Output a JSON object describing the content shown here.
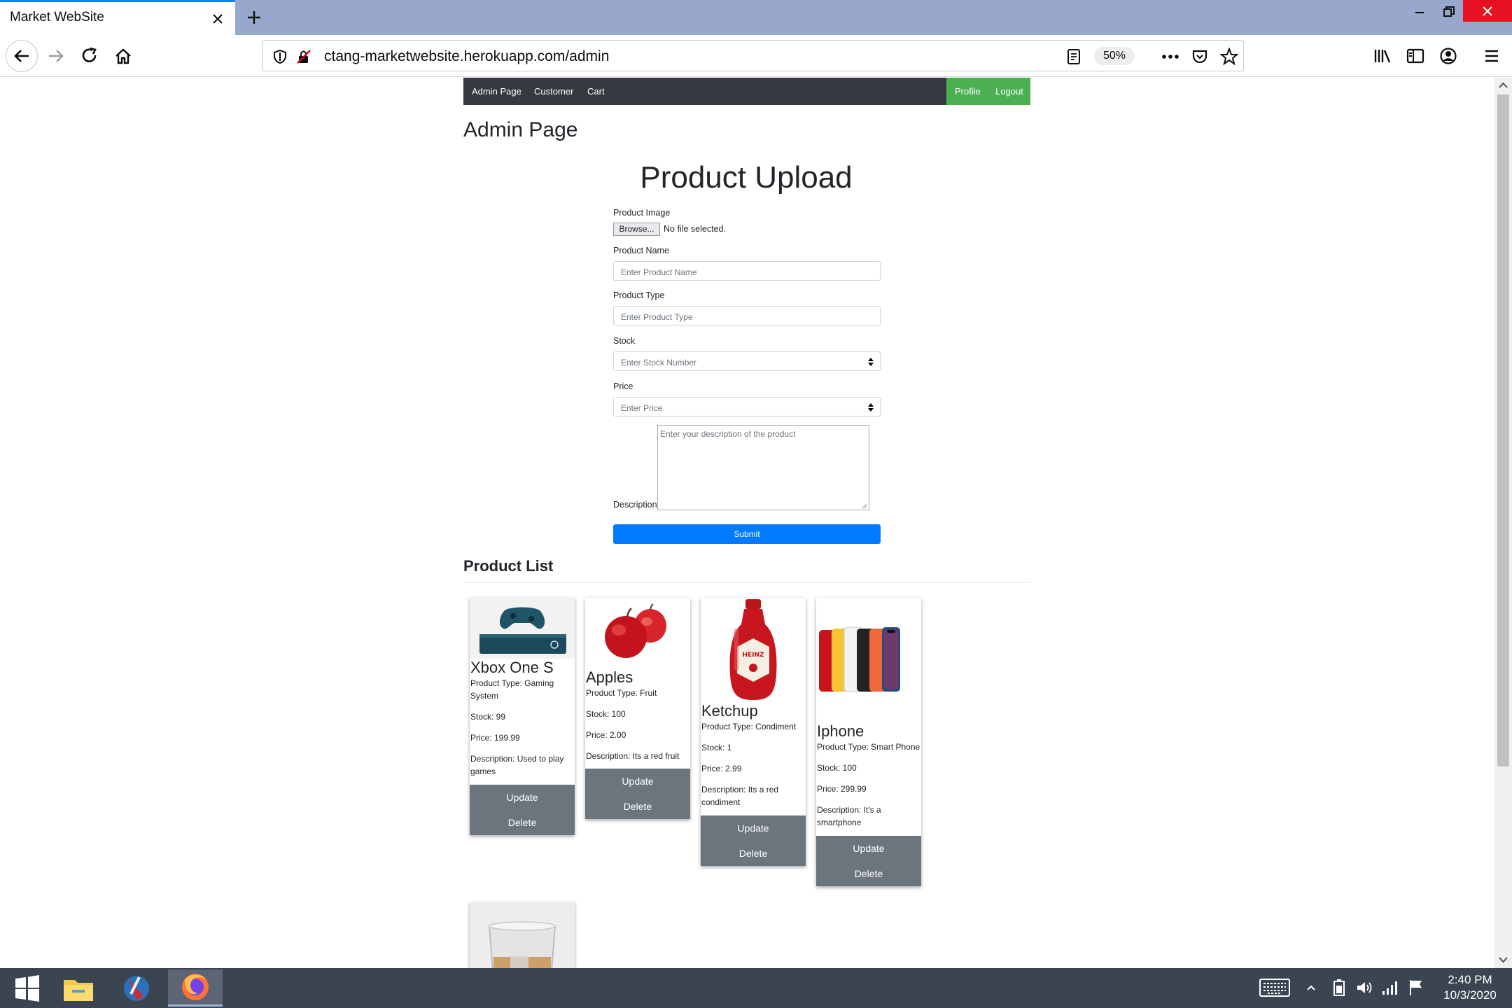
{
  "browser": {
    "tab_title": "Market WebSite",
    "url": "ctang-marketwebsite.herokuapp.com/admin",
    "zoom": "50%"
  },
  "site_nav": {
    "links": [
      "Admin Page",
      "Customer",
      "Cart"
    ],
    "right_links": [
      "Profile",
      "Logout"
    ]
  },
  "page": {
    "heading": "Admin Page"
  },
  "upload_form": {
    "title": "Product Upload",
    "image_label": "Product Image",
    "browse_label": "Browse...",
    "file_status": "No file selected.",
    "name_label": "Product Name",
    "name_placeholder": "Enter Product Name",
    "type_label": "Product Type",
    "type_placeholder": "Enter Product Type",
    "stock_label": "Stock",
    "stock_placeholder": "Enter Stock Number",
    "price_label": "Price",
    "price_placeholder": "Enter Price",
    "description_label": "Description",
    "description_placeholder": "Enter your description of the product",
    "submit_label": "Submit"
  },
  "product_list": {
    "heading": "Product List",
    "update_label": "Update",
    "delete_label": "Delete",
    "products": [
      {
        "name": "Xbox One S",
        "type": "Product Type: Gaming System",
        "stock": "Stock: 99",
        "price": "Price: 199.99",
        "description": "Description: Used to play games"
      },
      {
        "name": "Apples",
        "type": "Product Type: Fruit",
        "stock": "Stock: 100",
        "price": "Price: 2.00",
        "description": "Description: Its a red fruit"
      },
      {
        "name": "Ketchup",
        "type": "Product Type: Condiment",
        "stock": "Stock: 1",
        "price": "Price: 2.99",
        "description": "Description: Its a red condiment"
      },
      {
        "name": "Iphone",
        "type": "Product Type: Smart Phone",
        "stock": "Stock: 100",
        "price": "Price: 299.99",
        "description": "Description: It's a smartphone"
      }
    ]
  },
  "taskbar": {
    "time": "2:40 PM",
    "date": "10/3/2020"
  },
  "colors": {
    "nav_dark": "#343a40",
    "nav_green": "#4caf50",
    "submit_blue": "#007bff",
    "card_button_gray": "#6c757d"
  }
}
